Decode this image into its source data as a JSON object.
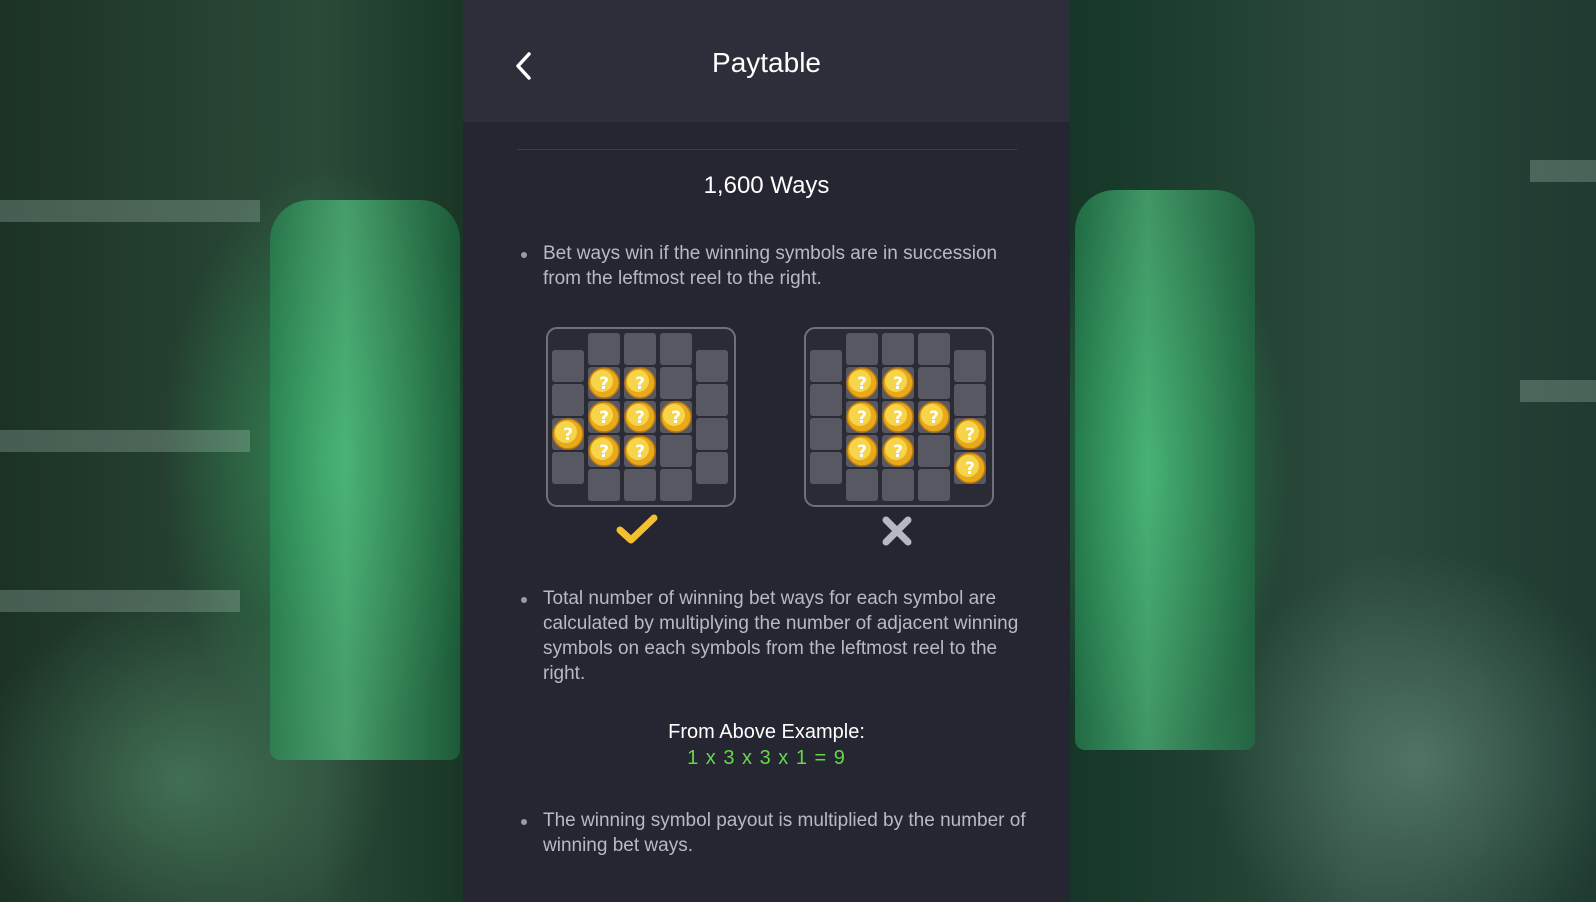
{
  "header": {
    "title": "Paytable"
  },
  "section": {
    "title": "1,600 Ways"
  },
  "bullets": [
    "Bet ways win if the winning symbols are in succession from the leftmost reel to the right.",
    "Total number of winning bet ways for each symbol are calculated by multiplying the number of adjacent winning symbols on each symbols from the leftmost reel to the right.",
    "The winning symbol payout is multiplied by the number of winning bet ways."
  ],
  "example": {
    "label": "From Above Example:",
    "formula": "1 x 3 x 3 x 1 = 9"
  },
  "colors": {
    "panel": "#262632",
    "header": "#2e2e3b",
    "cell": "#585863",
    "check": "#f2c030",
    "cross": "#b8b8c0",
    "formula": "#62d84a"
  },
  "icons": {
    "back": "chevron-left-icon",
    "valid": "checkmark-icon",
    "invalid": "cross-icon",
    "symbol": "question-coin-icon"
  },
  "grids": [
    {
      "verdict": "valid",
      "reels": [
        [
          null,
          null,
          "coin",
          null,
          null
        ],
        [
          null,
          "coin",
          "coin",
          "coin",
          null
        ],
        [
          null,
          "coin",
          "coin",
          "coin",
          null
        ],
        [
          null,
          null,
          "coin",
          null,
          null
        ],
        [
          null,
          null,
          null,
          null,
          null
        ]
      ]
    },
    {
      "verdict": "invalid",
      "reels": [
        [
          null,
          null,
          null,
          null,
          null
        ],
        [
          null,
          "coin",
          "coin",
          "coin",
          null
        ],
        [
          null,
          "coin",
          "coin",
          "coin",
          null
        ],
        [
          null,
          null,
          "coin",
          null,
          null
        ],
        [
          null,
          null,
          "coin",
          "coin",
          null
        ]
      ]
    }
  ]
}
